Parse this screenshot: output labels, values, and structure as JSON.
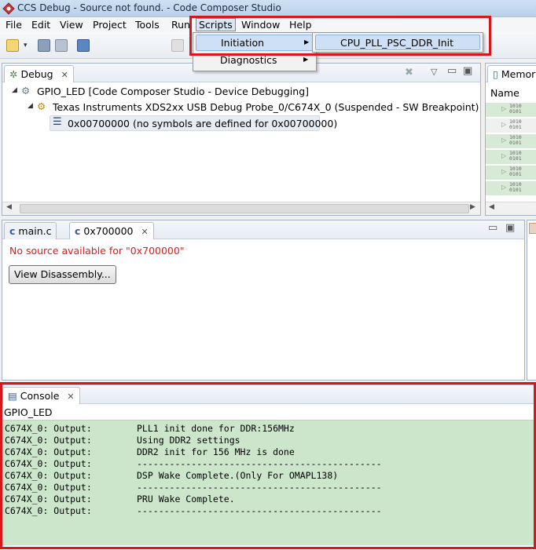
{
  "window": {
    "title": "CCS Debug - Source not found. - Code Composer Studio"
  },
  "menubar": {
    "items": [
      "File",
      "Edit",
      "View",
      "Project",
      "Tools",
      "Run",
      "Scripts",
      "Window",
      "Help"
    ]
  },
  "scripts_menu": {
    "items": [
      "Initiation",
      "Diagnostics"
    ],
    "submenu": [
      "CPU_PLL_PSC_DDR_Init"
    ]
  },
  "debug_view": {
    "tab_label": "Debug",
    "tree": [
      "GPIO_LED [Code Composer Studio - Device Debugging]",
      "Texas Instruments XDS2xx USB Debug Probe_0/C674X_0 (Suspended - SW Breakpoint)",
      "0x00700000  (no symbols are defined for 0x00700000)"
    ]
  },
  "memory_view": {
    "tab_label": "Memor",
    "column": "Name",
    "rows": 6,
    "row_glyph": "1010\n0101"
  },
  "editor": {
    "tabs": [
      "main.c",
      "0x700000"
    ],
    "message": "No source available for \"0x700000\"",
    "button_label": "View Disassembly..."
  },
  "console": {
    "tab_label": "Console",
    "title": "GPIO_LED",
    "lines": [
      {
        "src": "C674X_0: Output:",
        "msg": "PLL1 init done for DDR:156MHz"
      },
      {
        "src": "C674X_0: Output:",
        "msg": "Using DDR2 settings"
      },
      {
        "src": "C674X_0: Output:",
        "msg": "DDR2 init for 156 MHz is done"
      },
      {
        "src": "C674X_0: Output:",
        "msg": "---------------------------------------------"
      },
      {
        "src": "C674X_0: Output:",
        "msg": "DSP Wake Complete.(Only For OMAPL138)"
      },
      {
        "src": "C674X_0: Output:",
        "msg": "---------------------------------------------"
      },
      {
        "src": "C674X_0: Output:",
        "msg": "PRU Wake Complete."
      },
      {
        "src": "C674X_0: Output:",
        "msg": "---------------------------------------------"
      }
    ]
  },
  "colors": {
    "highlight": "#d9161c",
    "console_bg": "#cce6cc",
    "error_text": "#e01b1b",
    "menu_hover": "#cde0f5"
  }
}
